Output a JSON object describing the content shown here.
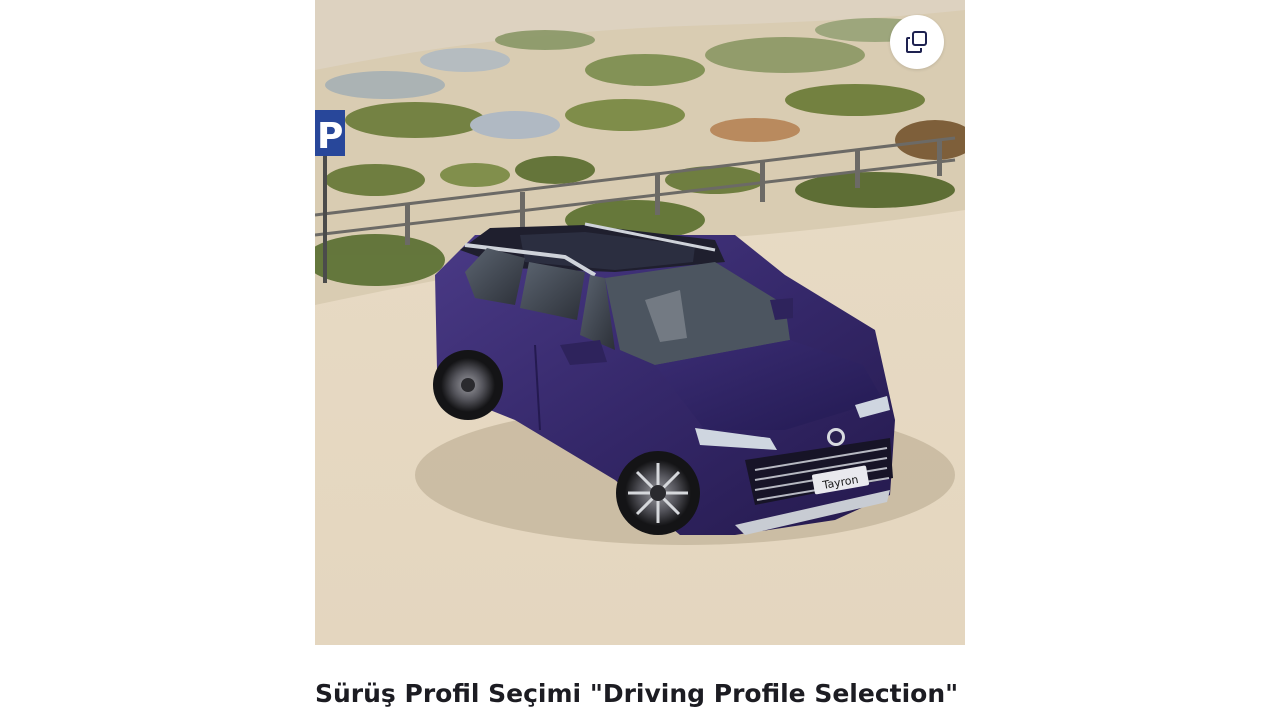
{
  "hero": {
    "image_subject": "car-photo",
    "badge_text": "Tayron",
    "sign_text": "P",
    "expand_icon": "copy-icon",
    "car_color": "#3a2b6e",
    "accent_color": "#1e2250"
  },
  "section": {
    "title": "Sürüş Profil Seçimi \"Driving Profile Selection\""
  }
}
